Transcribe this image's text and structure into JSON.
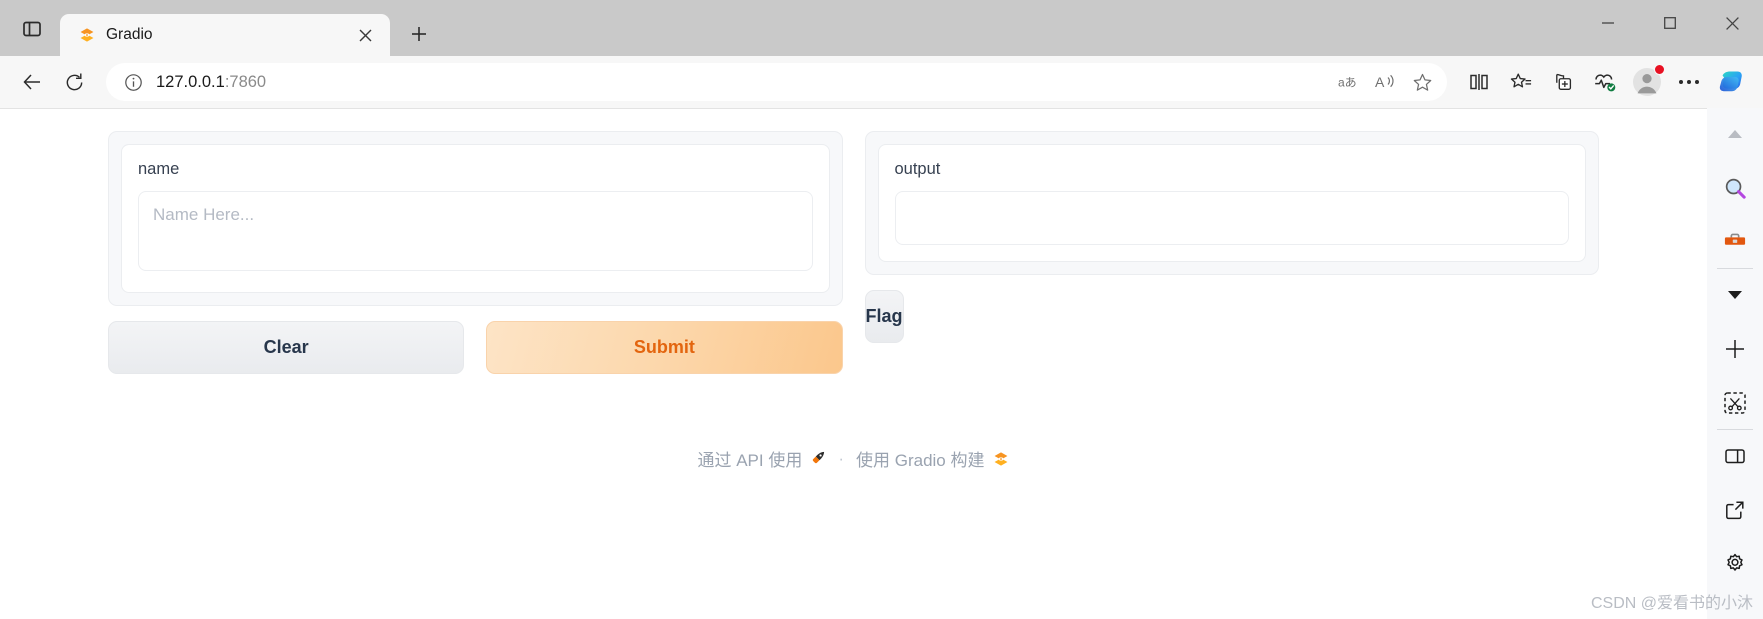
{
  "browser": {
    "window_controls": {
      "minimize_label": "Minimize",
      "maximize_label": "Maximize",
      "close_label": "Close"
    },
    "sidebar_toggle_label": "Tab actions / sidebar",
    "tabs": [
      {
        "title": "Gradio",
        "favicon": "gradio-logo-icon",
        "close_label": "Close tab"
      }
    ],
    "new_tab_label": "New tab",
    "nav": {
      "back_label": "Back",
      "refresh_label": "Refresh",
      "info_label": "View site information",
      "url_host": "127.0.0.1",
      "url_port": ":7860"
    },
    "omnibox_actions": [
      {
        "name": "translate-icon",
        "label": "Translate this page"
      },
      {
        "name": "read-aloud-icon",
        "label": "Read this page aloud"
      },
      {
        "name": "favorite-star-icon",
        "label": "Add this page to favorites"
      }
    ],
    "toolbar_right": [
      {
        "name": "split-screen-icon",
        "label": "Split screen"
      },
      {
        "name": "collections-icon",
        "label": "Collections"
      },
      {
        "name": "add-tab-group-icon",
        "label": "Add to tab group"
      },
      {
        "name": "browser-essentials-icon",
        "label": "Browser essentials"
      },
      {
        "name": "profile-avatar",
        "label": "Profile"
      },
      {
        "name": "settings-and-more-icon",
        "label": "Settings and more"
      },
      {
        "name": "copilot-icon",
        "label": "Copilot"
      }
    ]
  },
  "edge_sidebar": {
    "items": [
      {
        "name": "scroll-up-chevron-icon",
        "label": "Scroll up"
      },
      {
        "name": "search-magnifier-icon",
        "label": "Search"
      },
      {
        "name": "toolbox-icon",
        "label": "Tools"
      },
      {
        "name": "scroll-down-chevron-icon",
        "label": "Scroll down"
      },
      {
        "name": "add-icon",
        "label": "Add"
      },
      {
        "name": "screenshot-snip-icon",
        "label": "Screenshot"
      },
      {
        "name": "split-panel-icon",
        "label": "Split panel"
      },
      {
        "name": "open-external-icon",
        "label": "Open in new window"
      },
      {
        "name": "settings-gear-icon",
        "label": "Settings"
      }
    ]
  },
  "app": {
    "input": {
      "label": "name",
      "placeholder": "Name Here...",
      "value": ""
    },
    "output": {
      "label": "output",
      "value": ""
    },
    "buttons": {
      "clear": "Clear",
      "submit": "Submit",
      "flag": "Flag"
    },
    "footer": {
      "api_link": "通过 API 使用",
      "api_icon": "rocket-icon",
      "separator": "·",
      "built_with": "使用 Gradio 构建",
      "gradio_icon": "gradio-logo-icon"
    },
    "colors": {
      "primary": "#e3650f",
      "primary_bg_start": "#fde4c6",
      "primary_bg_end": "#fbc78c",
      "label_text": "#374151",
      "placeholder": "#b4bac4",
      "panel_bg": "#f7f8fa"
    }
  },
  "watermark": {
    "text": "CSDN @爱看书的小沐"
  }
}
